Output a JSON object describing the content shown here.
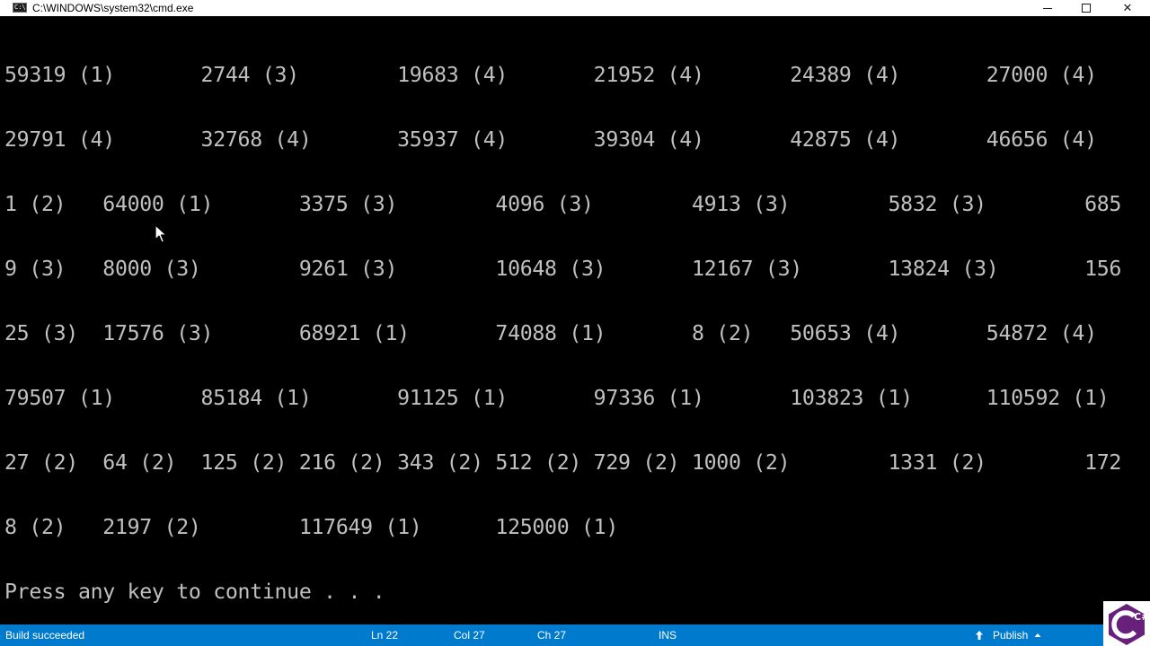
{
  "window": {
    "title": "C:\\WINDOWS\\system32\\cmd.exe",
    "icon": "console-app-icon",
    "icon_text": "C:\\.",
    "controls": {
      "minimize": "minimize-icon",
      "maximize": "maximize-icon",
      "close": "close-icon",
      "close_glyph": "✕"
    }
  },
  "console": {
    "text_color": "#c0c0c0",
    "background": "#000000",
    "lines": [
      "59319 (1)       2744 (3)        19683 (4)       21952 (4)       24389 (4)       27000 (4)",
      "29791 (4)       32768 (4)       35937 (4)       39304 (4)       42875 (4)       46656 (4)",
      "1 (2)   64000 (1)       3375 (3)        4096 (3)        4913 (3)        5832 (3)        685",
      "9 (3)   8000 (3)        9261 (3)        10648 (3)       12167 (3)       13824 (3)       156",
      "25 (3)  17576 (3)       68921 (1)       74088 (1)       8 (2)   50653 (4)       54872 (4)",
      "79507 (1)       85184 (1)       91125 (1)       97336 (1)       103823 (1)      110592 (1)",
      "27 (2)  64 (2)  125 (2) 216 (2) 343 (2) 512 (2) 729 (2) 1000 (2)        1331 (2)        172",
      "8 (2)   2197 (2)        117649 (1)      125000 (1)",
      "Press any key to continue . . ."
    ]
  },
  "cursor": {
    "icon": "mouse-pointer-icon"
  },
  "statusbar": {
    "background": "#007acc",
    "message": "Build succeeded",
    "line": "Ln 22",
    "column": "Col 27",
    "character": "Ch 27",
    "mode": "INS",
    "publish_label": "Publish",
    "publish_icon": "arrow-up-icon",
    "publish_caret_icon": "caret-up-icon"
  },
  "logo": {
    "icon": "csharp-logo-icon",
    "text": "C#",
    "color": "#68217a"
  }
}
